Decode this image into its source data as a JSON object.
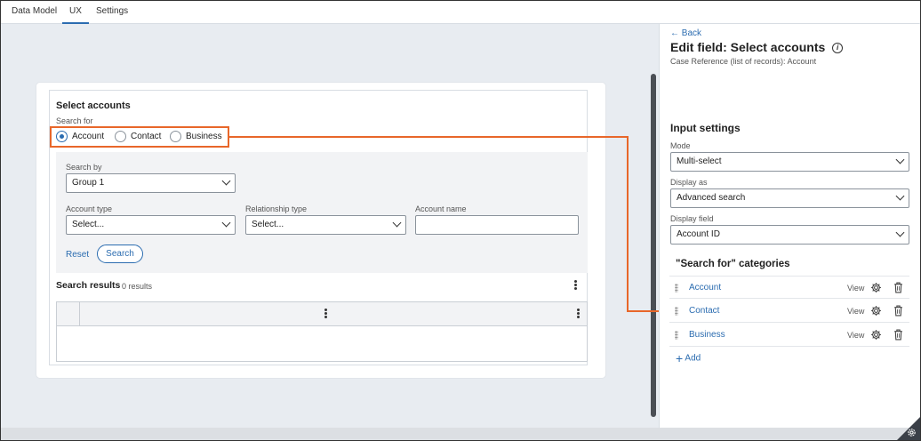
{
  "tabs": [
    {
      "label": "Data Model",
      "active": false
    },
    {
      "label": "UX",
      "active": true
    },
    {
      "label": "Settings",
      "active": false
    }
  ],
  "form": {
    "title": "Select accounts",
    "search_for_label": "Search for",
    "radios": [
      {
        "label": "Account",
        "selected": true
      },
      {
        "label": "Contact",
        "selected": false
      },
      {
        "label": "Business",
        "selected": false
      }
    ],
    "search_by_label": "Search by",
    "search_by_value": "Group 1",
    "account_type_label": "Account type",
    "account_type_value": "Select...",
    "relationship_type_label": "Relationship type",
    "relationship_type_value": "Select...",
    "account_name_label": "Account name",
    "account_name_value": "",
    "reset_label": "Reset",
    "search_label": "Search",
    "results_title": "Search results",
    "results_count": "0 results"
  },
  "panel": {
    "back_label": "Back",
    "title": "Edit field: Select accounts",
    "subtitle": "Case Reference (list of records): Account",
    "input_settings_title": "Input settings",
    "mode_label": "Mode",
    "mode_value": "Multi-select",
    "display_as_label": "Display as",
    "display_as_value": "Advanced search",
    "display_field_label": "Display field",
    "display_field_value": "Account ID",
    "categories_title": "\"Search for\" categories",
    "categories": [
      {
        "label": "Account",
        "view": "View"
      },
      {
        "label": "Contact",
        "view": "View"
      },
      {
        "label": "Business",
        "view": "View"
      }
    ],
    "add_label": "Add"
  },
  "colors": {
    "accent": "#2b6cb0",
    "highlight": "#e8672a"
  }
}
